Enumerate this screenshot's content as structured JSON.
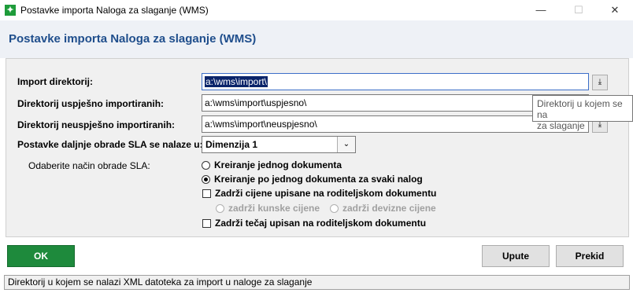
{
  "window": {
    "title": "Postavke importa Naloga za slaganje (WMS)",
    "minimize_icon": "minimize-icon",
    "maximize_icon": "maximize-icon",
    "close_icon": "close-icon"
  },
  "header": {
    "title": "Postavke importa Naloga za slaganje (WMS)"
  },
  "form": {
    "import_dir": {
      "label": "Import direktorij:",
      "value": "a:\\wms\\import\\"
    },
    "success_dir": {
      "label": "Direktorij uspješno importiranih:",
      "value": "a:\\wms\\import\\uspjesno\\"
    },
    "fail_dir": {
      "label": "Direktorij neuspješno importiranih:",
      "value": "a:\\wms\\import\\neuspjesno\\"
    },
    "sla_settings": {
      "label": "Postavke daljnje obrade SLA se nalaze u:",
      "value": "Dimenzija 1"
    },
    "sla_mode": {
      "label": "Odaberite način obrade SLA:",
      "option1": "Kreiranje jednog dokumenta",
      "option2": "Kreiranje po jednog dokumenta za svaki nalog",
      "selected": 2
    },
    "keep_prices": {
      "label": "Zadrži cijene upisane na roditeljskom dokumentu",
      "checked": false
    },
    "keep_kuna": "zadrži kunske cijene",
    "keep_foreign": "zadrži devizne cijene",
    "keep_rate": {
      "label": "Zadrži tečaj upisan na roditeljskom dokumentu",
      "checked": false
    }
  },
  "tooltip": {
    "line1": "Direktorij u kojem se na",
    "line2": "za slaganje"
  },
  "buttons": {
    "ok": "OK",
    "instructions": "Upute",
    "cancel": "Prekid"
  },
  "status": {
    "text": "Direktorij u kojem se nalazi XML datoteka za import u naloge za slaganje"
  },
  "colors": {
    "accent": "#1f4e8c",
    "ok_button": "#1e8a3c",
    "selection": "#0a246a"
  }
}
